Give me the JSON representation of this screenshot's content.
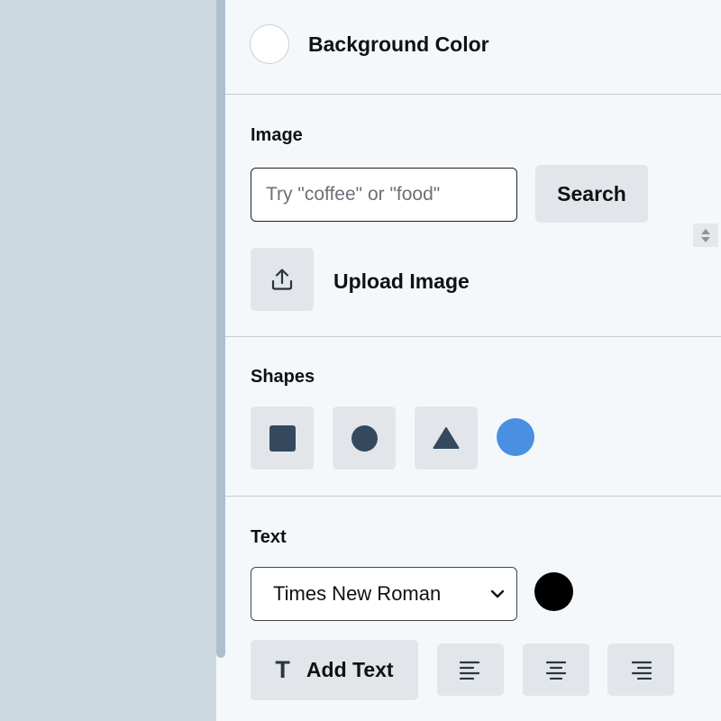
{
  "background": {
    "label": "Background Color",
    "swatch_color": "#ffffff",
    "swatch_icon": "color-swatch"
  },
  "image": {
    "section_label": "Image",
    "search_placeholder": "Try \"coffee\" or \"food\"",
    "search_value": "",
    "search_button": "Search",
    "upload_label": "Upload Image",
    "upload_icon": "upload-icon"
  },
  "shapes": {
    "section_label": "Shapes",
    "items": [
      {
        "name": "square",
        "icon": "square-icon"
      },
      {
        "name": "circle",
        "icon": "circle-icon"
      },
      {
        "name": "triangle",
        "icon": "triangle-icon"
      }
    ],
    "fill_color": "#4a90e2",
    "shape_color": "#34495e"
  },
  "text": {
    "section_label": "Text",
    "font_selected": "Times New Roman",
    "color": "#000000",
    "add_text_label": "Add Text",
    "add_text_icon_glyph": "T",
    "align_options": [
      "left",
      "center",
      "right"
    ]
  },
  "colors": {
    "panel_bg": "#f5f8fb",
    "canvas_bg": "#cdd9e1",
    "button_bg": "#e2e6ea",
    "divider": "#c5ccd3"
  }
}
